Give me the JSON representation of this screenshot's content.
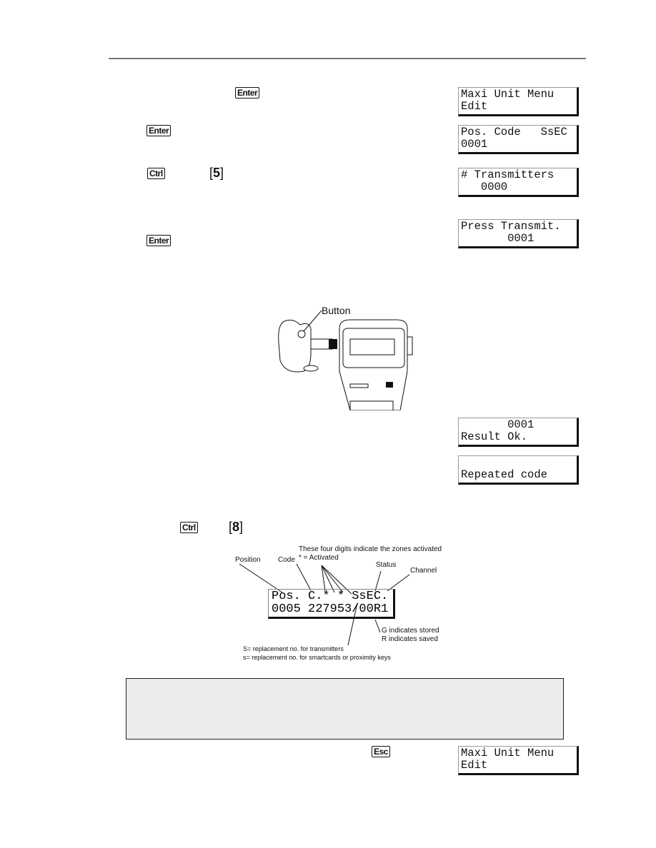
{
  "keys": {
    "enter": "Enter",
    "ctrl": "Ctrl",
    "five": "5",
    "eight": "8",
    "esc": "Esc"
  },
  "lcd_screens": [
    {
      "line1": "Maxi Unit Menu",
      "line2": "Edit"
    },
    {
      "line1": "Pos. Code   SsEC",
      "line2": "0001"
    },
    {
      "line1": "# Transmitters",
      "line2": "   0000"
    },
    {
      "line1": "Press Transmit.",
      "line2": "       0001"
    },
    {
      "line1": "       0001",
      "line2": "Result Ok."
    },
    {
      "line1": "",
      "line2": "Repeated code"
    },
    {
      "line1": "Maxi Unit Menu",
      "line2": "Edit"
    }
  ],
  "figure": {
    "button_label": "Button"
  },
  "diagram": {
    "lcd_line1": "Pos. C.* * SsEC.",
    "lcd_line2": "0005 227953/00R1",
    "labels": {
      "position": "Position",
      "code": "Code",
      "zones": "These four digits indicate the zones activated",
      "activated": "* = Activated",
      "status": "Status",
      "channel": "Channel",
      "stored": "G indicates stored",
      "saved": "R indicates saved",
      "s_upper": "S= replacement no. for transmitters",
      "s_lower": "s= replacement no. for smartcards or proximity keys"
    }
  }
}
